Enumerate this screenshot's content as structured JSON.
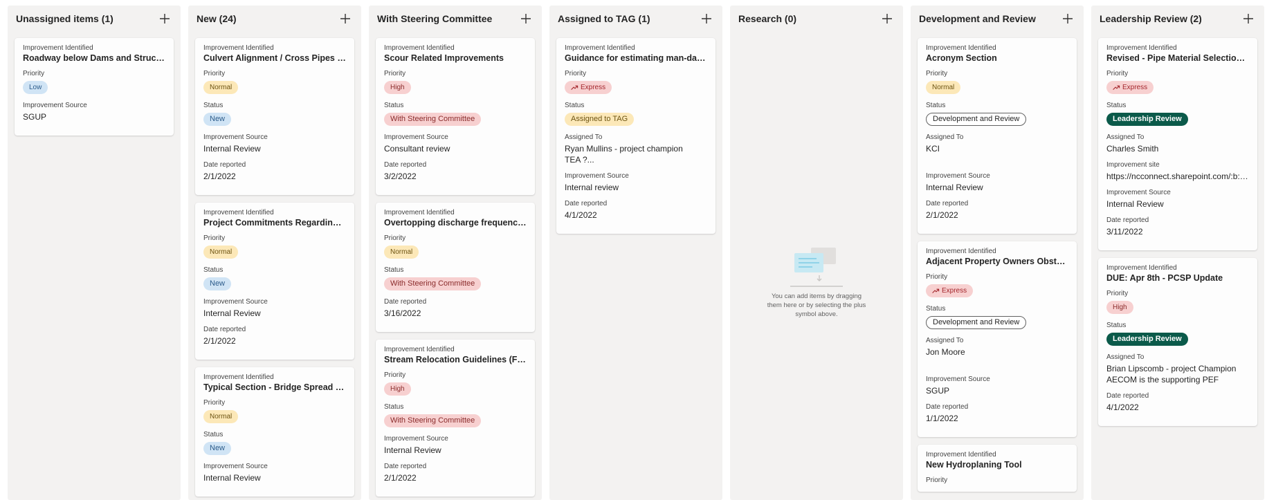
{
  "columns": [
    {
      "title": "Unassigned items (1)",
      "cards": [
        {
          "fields": [
            {
              "label": "Improvement Identified",
              "value": "Roadway below Dams and Structures",
              "type": "title"
            },
            {
              "label": "Priority",
              "value": "Low",
              "type": "pill",
              "style": "p-low"
            },
            {
              "label": "Improvement Source",
              "value": "SGUP",
              "type": "text"
            }
          ]
        }
      ]
    },
    {
      "title": "New (24)",
      "cards": [
        {
          "fields": [
            {
              "label": "Improvement Identified",
              "value": "Culvert Alignment / Cross Pipes and Culverts",
              "type": "title"
            },
            {
              "label": "Priority",
              "value": "Normal",
              "type": "pill",
              "style": "p-normal"
            },
            {
              "label": "Status",
              "value": "New",
              "type": "pill",
              "style": "s-new"
            },
            {
              "label": "Improvement Source",
              "value": "Internal Review",
              "type": "text"
            },
            {
              "label": "Date reported",
              "value": "2/1/2022",
              "type": "text"
            }
          ]
        },
        {
          "fields": [
            {
              "label": "Improvement Identified",
              "value": "Project Commitments Regarding Environmental",
              "type": "title"
            },
            {
              "label": "Priority",
              "value": "Normal",
              "type": "pill",
              "style": "p-normal"
            },
            {
              "label": "Status",
              "value": "New",
              "type": "pill",
              "style": "s-new"
            },
            {
              "label": "Improvement Source",
              "value": "Internal Review",
              "type": "text"
            },
            {
              "label": "Date reported",
              "value": "2/1/2022",
              "type": "text"
            }
          ]
        },
        {
          "fields": [
            {
              "label": "Improvement Identified",
              "value": "Typical Section - Bridge Spread Criteria",
              "type": "title"
            },
            {
              "label": "Priority",
              "value": "Normal",
              "type": "pill",
              "style": "p-normal"
            },
            {
              "label": "Status",
              "value": "New",
              "type": "pill",
              "style": "s-new"
            },
            {
              "label": "Improvement Source",
              "value": "Internal Review",
              "type": "text"
            }
          ]
        }
      ]
    },
    {
      "title": "With Steering Committee",
      "cards": [
        {
          "fields": [
            {
              "label": "Improvement Identified",
              "value": "Scour Related Improvements",
              "type": "title"
            },
            {
              "label": "Priority",
              "value": "High",
              "type": "pill",
              "style": "p-high"
            },
            {
              "label": "Status",
              "value": "With Steering Committee",
              "type": "pill",
              "style": "s-steer"
            },
            {
              "label": "Improvement Source",
              "value": "Consultant review",
              "type": "text"
            },
            {
              "label": "Date reported",
              "value": "3/2/2022",
              "type": "text"
            }
          ]
        },
        {
          "fields": [
            {
              "label": "Improvement Identified",
              "value": "Overtopping discharge frequencies",
              "type": "title"
            },
            {
              "label": "Priority",
              "value": "Normal",
              "type": "pill",
              "style": "p-normal"
            },
            {
              "label": "Status",
              "value": "With Steering Committee",
              "type": "pill",
              "style": "s-steer"
            },
            {
              "label": "Date reported",
              "value": "3/16/2022",
              "type": "text"
            }
          ]
        },
        {
          "fields": [
            {
              "label": "Improvement Identified",
              "value": "Stream Relocation Guidelines (For Design)",
              "type": "title"
            },
            {
              "label": "Priority",
              "value": "High",
              "type": "pill",
              "style": "p-high"
            },
            {
              "label": "Status",
              "value": "With Steering Committee",
              "type": "pill",
              "style": "s-steer"
            },
            {
              "label": "Improvement Source",
              "value": "Internal Review",
              "type": "text"
            },
            {
              "label": "Date reported",
              "value": "2/1/2022",
              "type": "text"
            }
          ]
        }
      ]
    },
    {
      "title": "Assigned to TAG (1)",
      "cards": [
        {
          "fields": [
            {
              "label": "Improvement Identified",
              "value": "Guidance for estimating man-day hours",
              "type": "title"
            },
            {
              "label": "Priority",
              "value": "Express",
              "type": "pill",
              "style": "p-express",
              "icon": "trending-up-icon"
            },
            {
              "label": "Status",
              "value": "Assigned to TAG",
              "type": "pill",
              "style": "s-tag"
            },
            {
              "label": "Assigned To",
              "value": "Ryan Mullins - project champion\nTEA ?...",
              "type": "multi"
            },
            {
              "label": "Improvement Source",
              "value": "Internal review",
              "type": "text"
            },
            {
              "label": "Date reported",
              "value": "4/1/2022",
              "type": "text"
            }
          ]
        }
      ]
    },
    {
      "title": "Research (0)",
      "cards": [],
      "empty_text": "You can add items by dragging them here or by selecting the plus symbol above."
    },
    {
      "title": "Development and Review",
      "cards": [
        {
          "fields": [
            {
              "label": "Improvement Identified",
              "value": "Acronym Section",
              "type": "title"
            },
            {
              "label": "Priority",
              "value": "Normal",
              "type": "pill",
              "style": "p-normal"
            },
            {
              "label": "Status",
              "value": "Development and Review",
              "type": "pill",
              "style": "s-dev"
            },
            {
              "label": "Assigned To",
              "value": "KCI",
              "type": "tall"
            },
            {
              "label": "Improvement Source",
              "value": "Internal Review",
              "type": "text"
            },
            {
              "label": "Date reported",
              "value": "2/1/2022",
              "type": "text"
            }
          ]
        },
        {
          "fields": [
            {
              "label": "Improvement Identified",
              "value": "Adjacent Property Owners Obstructions",
              "type": "title"
            },
            {
              "label": "Priority",
              "value": "Express",
              "type": "pill",
              "style": "p-express",
              "icon": "trending-up-icon"
            },
            {
              "label": "Status",
              "value": "Development and Review",
              "type": "pill",
              "style": "s-dev"
            },
            {
              "label": "Assigned To",
              "value": "Jon Moore",
              "type": "tall"
            },
            {
              "label": "Improvement Source",
              "value": "SGUP",
              "type": "text"
            },
            {
              "label": "Date reported",
              "value": "1/1/2022",
              "type": "text"
            }
          ]
        },
        {
          "fields": [
            {
              "label": "Improvement Identified",
              "value": "New Hydroplaning Tool",
              "type": "title"
            },
            {
              "label": "Priority",
              "value": "",
              "type": "none"
            }
          ]
        }
      ]
    },
    {
      "title": "Leadership Review (2)",
      "cards": [
        {
          "fields": [
            {
              "label": "Improvement Identified",
              "value": "Revised - Pipe Material Selection Guide",
              "type": "title"
            },
            {
              "label": "Priority",
              "value": "Express",
              "type": "pill",
              "style": "p-express",
              "icon": "trending-up-icon"
            },
            {
              "label": "Status",
              "value": "Leadership Review",
              "type": "pill",
              "style": "s-lead"
            },
            {
              "label": "Assigned To",
              "value": "Charles Smith",
              "type": "text"
            },
            {
              "label": "Improvement site",
              "value": "https://ncconnect.sharepoint.com/:b:/...",
              "type": "text"
            },
            {
              "label": "Improvement Source",
              "value": "Internal Review",
              "type": "text"
            },
            {
              "label": "Date reported",
              "value": "3/11/2022",
              "type": "text"
            }
          ]
        },
        {
          "fields": [
            {
              "label": "Improvement Identified",
              "value": "DUE: Apr 8th - PCSP Update",
              "type": "title"
            },
            {
              "label": "Priority",
              "value": "High",
              "type": "pill",
              "style": "p-high"
            },
            {
              "label": "Status",
              "value": "Leadership Review",
              "type": "pill",
              "style": "s-lead"
            },
            {
              "label": "Assigned To",
              "value": "Brian Lipscomb - project Champion\nAECOM is the supporting PEF",
              "type": "multi"
            },
            {
              "label": "Date reported",
              "value": "4/1/2022",
              "type": "text"
            }
          ]
        }
      ]
    }
  ]
}
